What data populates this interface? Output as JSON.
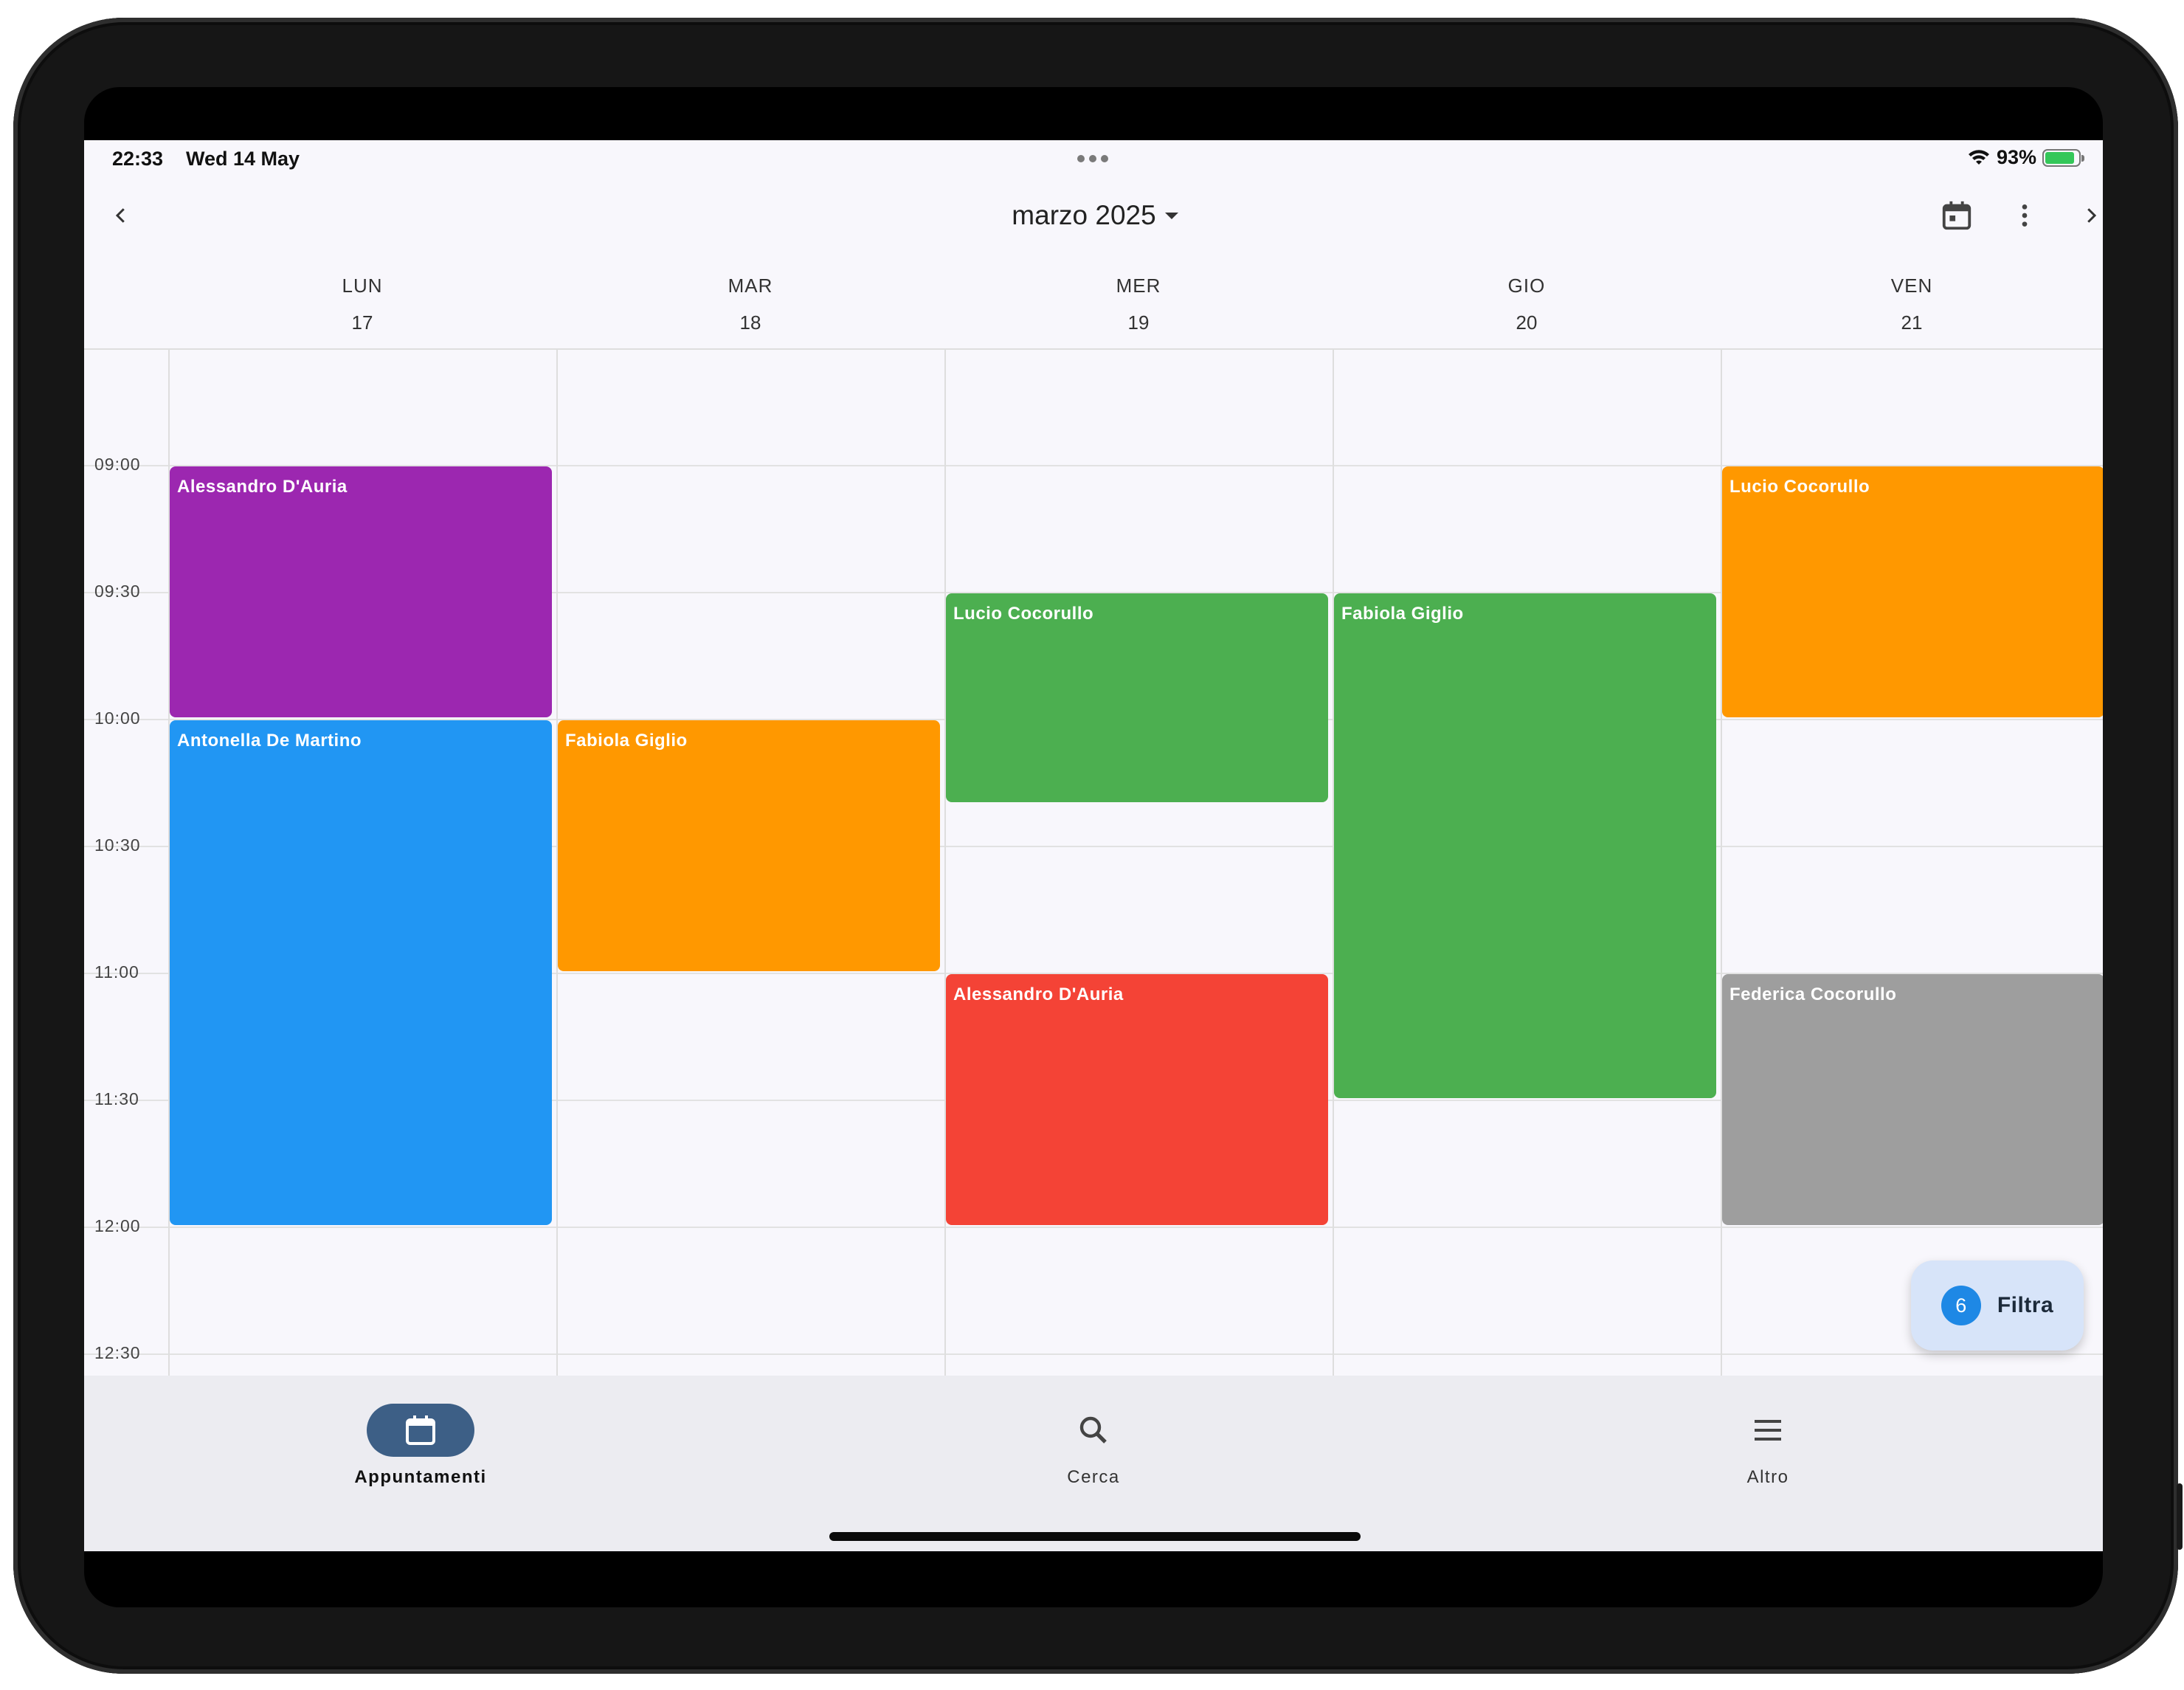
{
  "status_bar": {
    "time": "22:33",
    "date": "Wed 14 May",
    "battery": "93%"
  },
  "header": {
    "month_title": "marzo 2025"
  },
  "days": [
    {
      "name": "LUN",
      "date": "17"
    },
    {
      "name": "MAR",
      "date": "18"
    },
    {
      "name": "MER",
      "date": "19"
    },
    {
      "name": "GIO",
      "date": "20"
    },
    {
      "name": "VEN",
      "date": "21"
    }
  ],
  "time_labels": [
    "09:00",
    "09:30",
    "10:00",
    "10:30",
    "11:00",
    "11:30",
    "12:00",
    "12:30"
  ],
  "events": [
    {
      "name": "Alessandro D'Auria",
      "day": "LUN",
      "start": "09:00",
      "end": "10:00",
      "color": "#9c27b0"
    },
    {
      "name": "Antonella De Martino",
      "day": "LUN",
      "start": "10:00",
      "end": "12:00",
      "color": "#2196f3"
    },
    {
      "name": "Fabiola Giglio",
      "day": "MAR",
      "start": "10:00",
      "end": "11:00",
      "color": "#ff9800"
    },
    {
      "name": "Lucio Cocorullo",
      "day": "MER",
      "start": "09:30",
      "end": "10:20",
      "color": "#4caf50"
    },
    {
      "name": "Alessandro D'Auria",
      "day": "MER",
      "start": "11:00",
      "end": "12:00",
      "color": "#f44336"
    },
    {
      "name": "Fabiola Giglio",
      "day": "GIO",
      "start": "09:30",
      "end": "11:30",
      "color": "#4caf50"
    },
    {
      "name": "Lucio Cocorullo",
      "day": "VEN",
      "start": "09:00",
      "end": "10:00",
      "color": "#ff9800"
    },
    {
      "name": "Federica Cocorullo",
      "day": "VEN",
      "start": "11:00",
      "end": "12:00",
      "color": "#9e9e9e"
    }
  ],
  "filter": {
    "count": "6",
    "label": "Filtra"
  },
  "nav": {
    "items": [
      {
        "label": "Appuntamenti",
        "icon": "calendar-icon",
        "active": true
      },
      {
        "label": "Cerca",
        "icon": "search-icon",
        "active": false
      },
      {
        "label": "Altro",
        "icon": "menu-icon",
        "active": false
      }
    ]
  },
  "colors": {
    "accent": "#3d5f86",
    "fab": "#d7e4f9",
    "badge": "#1e88e5"
  }
}
